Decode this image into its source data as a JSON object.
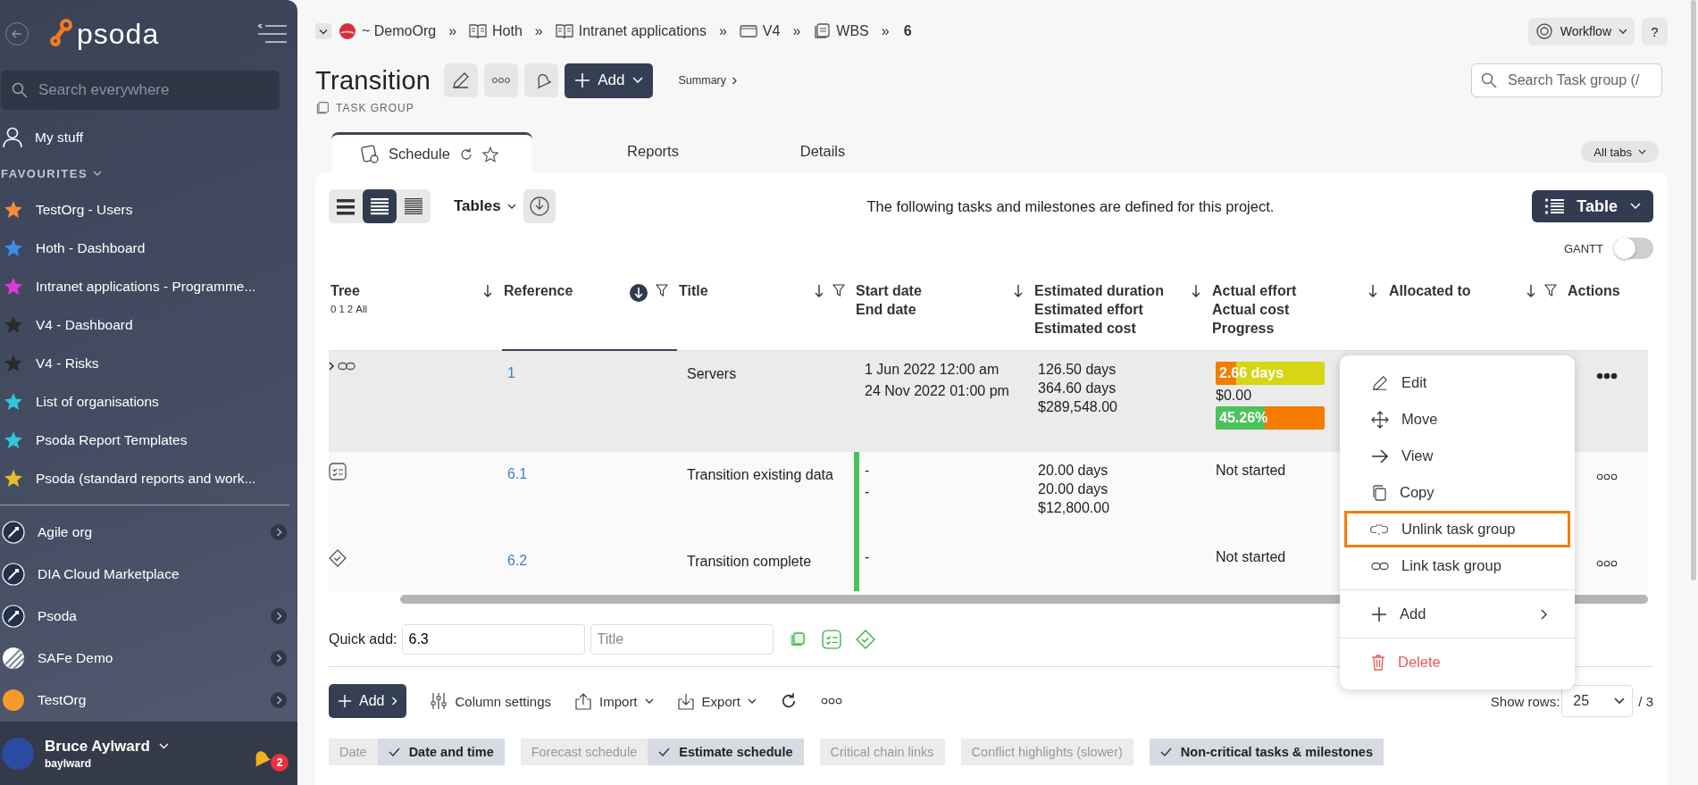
{
  "sidebar": {
    "logo": "psoda",
    "search": {
      "placeholder": "Search everywhere"
    },
    "my_stuff": "My stuff",
    "favourites_label": "FAVOURITES",
    "favourites": [
      {
        "label": "TestOrg - Users",
        "color": "#f28c38"
      },
      {
        "label": "Hoth - Dashboard",
        "color": "#3b8ee8"
      },
      {
        "label": "Intranet applications - Programme...",
        "color": "#e03ad6"
      },
      {
        "label": "V4 - Dashboard",
        "color": "#2a2a2a"
      },
      {
        "label": "V4 - Risks",
        "color": "#2a2a2a"
      },
      {
        "label": "List of organisations",
        "color": "#2fc6d8"
      },
      {
        "label": "Psoda Report Templates",
        "color": "#2fc6d8"
      },
      {
        "label": "Psoda (standard reports and work...",
        "color": "#e2be2a"
      }
    ],
    "organisations": [
      {
        "label": "Agile org",
        "kind": "rocket",
        "expandable": true
      },
      {
        "label": "DIA Cloud Marketplace",
        "kind": "rocket",
        "expandable": false
      },
      {
        "label": "Psoda",
        "kind": "rocket",
        "expandable": true
      },
      {
        "label": "SAFe Demo",
        "kind": "stripes",
        "expandable": true
      },
      {
        "label": "TestOrg",
        "kind": "sun",
        "expandable": true
      }
    ],
    "user": {
      "name": "Bruce Aylward",
      "username": "baylward",
      "notifications": "2"
    }
  },
  "breadcrumb": [
    {
      "label": "~ DemoOrg",
      "kind": "org",
      "separator": "»"
    },
    {
      "label": "Hoth",
      "kind": "book",
      "separator": "»"
    },
    {
      "label": "Intranet applications",
      "kind": "book",
      "separator": "»"
    },
    {
      "label": "V4",
      "kind": "folder",
      "separator": "»"
    },
    {
      "label": "WBS",
      "kind": "wbs",
      "separator": "»"
    },
    {
      "label": "6",
      "kind": "current"
    }
  ],
  "top_actions": {
    "workflow": "Workflow",
    "help": "?",
    "search": {
      "placeholder": "Search Task group (/"
    }
  },
  "header": {
    "title": "Transition",
    "type_label": "TASK GROUP",
    "add": "Add",
    "summary": "Summary"
  },
  "tabs": [
    {
      "label": "Schedule",
      "selected": true
    },
    {
      "label": "Reports",
      "selected": false
    },
    {
      "label": "Details",
      "selected": false
    }
  ],
  "all_tabs": "All tabs",
  "toolbar": {
    "density": [
      {
        "selected": false
      },
      {
        "selected": true
      },
      {
        "selected": false
      }
    ],
    "tables": "Tables",
    "description": "The following tasks and milestones are defined for this project.",
    "view": "Table",
    "gantt": {
      "label": "GANTT",
      "on": false
    }
  },
  "columns": [
    {
      "lines": [
        "Tree"
      ],
      "sortable": true,
      "sorted": false,
      "filter": false
    },
    {
      "lines": [
        "Reference"
      ],
      "sortable": true,
      "sorted": true,
      "filter": true
    },
    {
      "lines": [
        "Title"
      ],
      "sortable": true,
      "sorted": false,
      "filter": true
    },
    {
      "lines": [
        "Start date",
        "End date"
      ],
      "sortable": true,
      "sorted": false,
      "filter": false
    },
    {
      "lines": [
        "Estimated duration",
        "Estimated effort",
        "Estimated cost"
      ],
      "sortable": true,
      "sorted": false,
      "filter": false
    },
    {
      "lines": [
        "Actual effort",
        "Actual cost",
        "Progress"
      ],
      "sortable": true,
      "sorted": false,
      "filter": false
    },
    {
      "lines": [
        "Allocated to"
      ],
      "sortable": true,
      "sorted": false,
      "filter": true
    },
    {
      "lines": [
        "Actions"
      ],
      "sortable": false,
      "filter": false
    }
  ],
  "tree_levels": [
    "0",
    "1",
    "2",
    "All"
  ],
  "rows": [
    {
      "kind": "group",
      "expandable": true,
      "selected": true,
      "reference": "1",
      "title": "Servers",
      "dates": [
        "1 Jun 2022 12:00 am",
        "24 Nov 2022 01:00 pm"
      ],
      "estimates": [
        "126.50 days",
        "364.60 days",
        "$289,548.00"
      ],
      "actual": {
        "kind": "bars",
        "effort": {
          "text": "2.66 days",
          "level": 0.19
        },
        "cost": "$0.00",
        "progress": {
          "text": "45.26%",
          "level": 0.4526
        }
      }
    },
    {
      "kind": "task",
      "expandable": false,
      "selected": false,
      "color": "#4cc25a",
      "reference": "6.1",
      "title": "Transition existing data",
      "dates": [
        "-",
        "-"
      ],
      "estimates": [
        "20.00 days",
        "20.00 days",
        "$12,800.00"
      ],
      "actual": {
        "kind": "text",
        "text": "Not started"
      }
    },
    {
      "kind": "milestone",
      "expandable": false,
      "selected": false,
      "color": "#4cc25a",
      "reference": "6.2",
      "title": "Transition complete",
      "dates": [
        "-"
      ],
      "estimates": [],
      "actual": {
        "kind": "text",
        "text": "Not started"
      }
    }
  ],
  "context_menu": [
    {
      "label": "Edit",
      "kind": "edit",
      "selected": false,
      "divider_before": false,
      "danger": false,
      "submenu": false
    },
    {
      "label": "Move",
      "kind": "move",
      "selected": false,
      "divider_before": false,
      "danger": false,
      "submenu": false
    },
    {
      "label": "View",
      "kind": "view",
      "selected": false,
      "divider_before": false,
      "danger": false,
      "submenu": false
    },
    {
      "label": "Copy",
      "kind": "copy",
      "selected": false,
      "divider_before": false,
      "danger": false,
      "submenu": false
    },
    {
      "label": "Unlink task group",
      "kind": "unlink",
      "selected": true,
      "divider_before": false,
      "danger": false,
      "submenu": false
    },
    {
      "label": "Link task group",
      "kind": "link",
      "selected": false,
      "divider_before": false,
      "danger": false,
      "submenu": false
    },
    {
      "label": "Add",
      "kind": "add",
      "selected": false,
      "divider_before": true,
      "danger": false,
      "submenu": true
    },
    {
      "label": "Delete",
      "kind": "delete",
      "selected": false,
      "divider_before": true,
      "danger": true,
      "submenu": false
    }
  ],
  "quick_add": {
    "label": "Quick add:",
    "value": "6.3",
    "placeholder": "Title"
  },
  "bottom_toolbar": {
    "add": "Add",
    "column_settings": "Column settings",
    "import": "Import",
    "export": "Export",
    "show_rows": "Show rows:",
    "rows_value": "25",
    "pages": "/ 3"
  },
  "toggles": [
    [
      {
        "label": "Date",
        "checked": false
      },
      {
        "label": "Date and time",
        "checked": true
      }
    ],
    [
      {
        "label": "Forecast schedule",
        "checked": false
      },
      {
        "label": "Estimate schedule",
        "checked": true
      }
    ],
    [
      {
        "label": "Critical chain links",
        "checked": false
      }
    ],
    [
      {
        "label": "Conflict highlights (slower)",
        "checked": false
      }
    ],
    [
      {
        "label": "Non-critical tasks & milestones",
        "checked": true
      }
    ]
  ]
}
